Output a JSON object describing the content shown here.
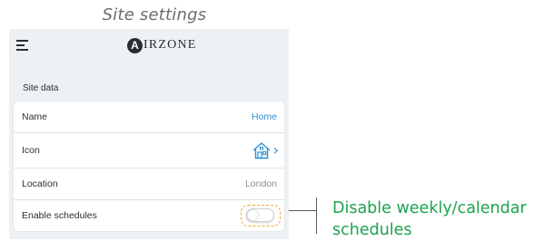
{
  "page": {
    "title": "Site settings"
  },
  "header": {
    "logo_mark": "A",
    "logo_text": "IRZONE",
    "menu_icon": "hamburger-icon"
  },
  "site_data": {
    "section_label": "Site data",
    "rows": [
      {
        "label": "Name",
        "value": "Home"
      },
      {
        "label": "Icon",
        "icon": "house-icon",
        "chevron": "›"
      },
      {
        "label": "Location",
        "value": "London"
      },
      {
        "label": "Enable schedules",
        "toggle_on": false
      }
    ]
  },
  "callout": {
    "text": "Disable weekly/calendar schedules"
  },
  "colors": {
    "accent_blue": "#2e8fd4",
    "callout_green": "#1ba34f",
    "highlight_orange": "#f0a830",
    "app_background": "#edf1f4"
  }
}
